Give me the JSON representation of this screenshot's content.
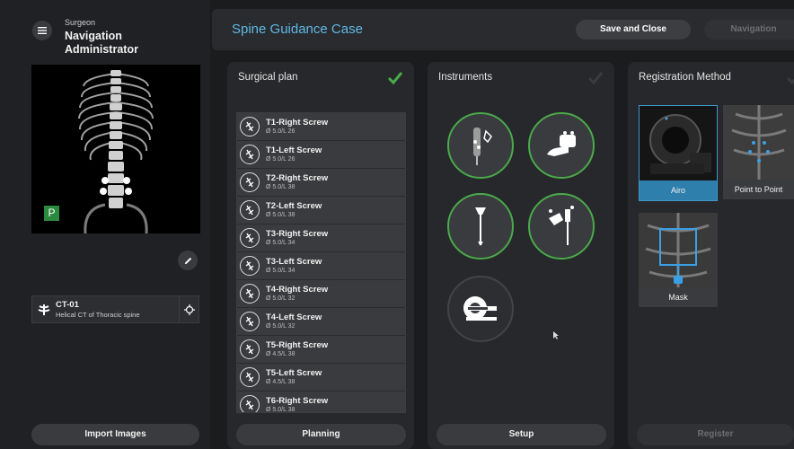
{
  "sidebar": {
    "role": "Surgeon",
    "user": "Navigation Administrator",
    "badge": "P",
    "ct": {
      "name": "CT-01",
      "desc": "Helical CT of Thoracic spine"
    },
    "import_label": "Import Images"
  },
  "header": {
    "title": "Spine Guidance Case",
    "save_label": "Save and Close",
    "navigation_label": "Navigation"
  },
  "surgical_plan": {
    "title": "Surgical plan",
    "screws": [
      {
        "name": "T1-Right Screw",
        "spec": "Ø 5.0/L 26"
      },
      {
        "name": "T1-Left Screw",
        "spec": "Ø 5.0/L 26"
      },
      {
        "name": "T2-Right Screw",
        "spec": "Ø 5.0/L 38"
      },
      {
        "name": "T2-Left Screw",
        "spec": "Ø 5.0/L 38"
      },
      {
        "name": "T3-Right Screw",
        "spec": "Ø 5.0/L 34"
      },
      {
        "name": "T3-Left Screw",
        "spec": "Ø 5.0/L 34"
      },
      {
        "name": "T4-Right Screw",
        "spec": "Ø 5.0/L 32"
      },
      {
        "name": "T4-Left Screw",
        "spec": "Ø 5.0/L 32"
      },
      {
        "name": "T5-Right Screw",
        "spec": "Ø 4.5/L 38"
      },
      {
        "name": "T5-Left Screw",
        "spec": "Ø 4.5/L 38"
      },
      {
        "name": "T6-Right Screw",
        "spec": "Ø 5.0/L 38"
      }
    ],
    "button_label": "Planning"
  },
  "instruments": {
    "title": "Instruments",
    "button_label": "Setup"
  },
  "registration": {
    "title": "Registration Method",
    "methods": [
      {
        "label": "Airo"
      },
      {
        "label": "Point to Point"
      },
      {
        "label": "Mask"
      }
    ],
    "button_label": "Register"
  },
  "colors": {
    "accent_blue": "#5fb8e6",
    "check_green": "#4aaa4a",
    "selected_blue": "#2f7fad"
  }
}
